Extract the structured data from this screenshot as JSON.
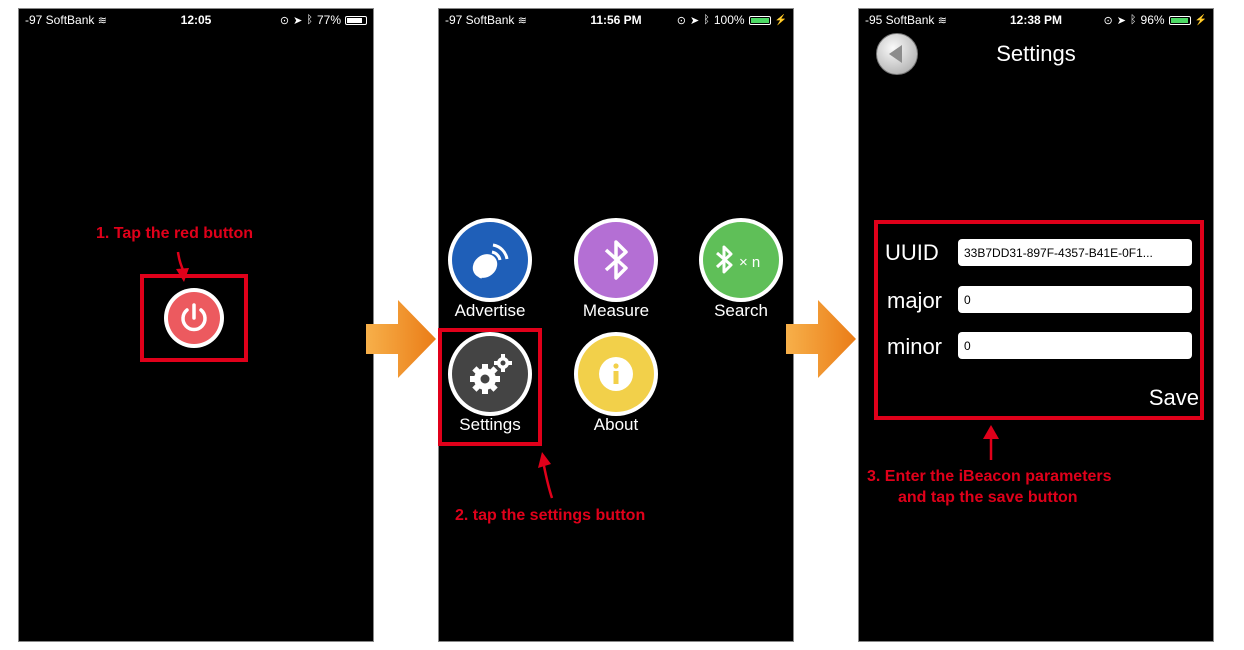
{
  "colors": {
    "annotation_red": "#e0001a",
    "step_arrow_orange": "#f39a30"
  },
  "screens": [
    {
      "status": {
        "carrier": "-97 SoftBank",
        "time": "12:05",
        "battery": "77%",
        "battery_level": 0.77
      },
      "power_button": {
        "icon": "power-icon",
        "color": "#ec5a5f"
      },
      "caption": "1. Tap the red button"
    },
    {
      "status": {
        "carrier": "-97 SoftBank",
        "time": "11:56 PM",
        "battery": "100%",
        "battery_level": 1.0
      },
      "menu": [
        {
          "label": "Advertise",
          "icon": "satellite-dish-icon",
          "color": "#1f5fb8"
        },
        {
          "label": "Measure",
          "icon": "bluetooth-icon",
          "color": "#b46fd4"
        },
        {
          "label": "Search",
          "icon": "bluetooth-x-n-icon",
          "color": "#5fbf58",
          "icon_text": "× n"
        },
        {
          "label": "Settings",
          "icon": "gears-icon",
          "color": "#444444"
        },
        {
          "label": "About",
          "icon": "info-icon",
          "color": "#f2d04a"
        }
      ],
      "caption": "2. tap the settings button"
    },
    {
      "status": {
        "carrier": "-95 SoftBank",
        "time": "12:38 PM",
        "battery": "96%",
        "battery_level": 0.96
      },
      "title": "Settings",
      "fields": [
        {
          "label": "UUID",
          "value": "33B7DD31-897F-4357-B41E-0F1..."
        },
        {
          "label": "major",
          "value": "0"
        },
        {
          "label": "minor",
          "value": "0"
        }
      ],
      "save_label": "Save",
      "caption_line1": "3. Enter the iBeacon parameters",
      "caption_line2": "and tap the save button"
    }
  ]
}
